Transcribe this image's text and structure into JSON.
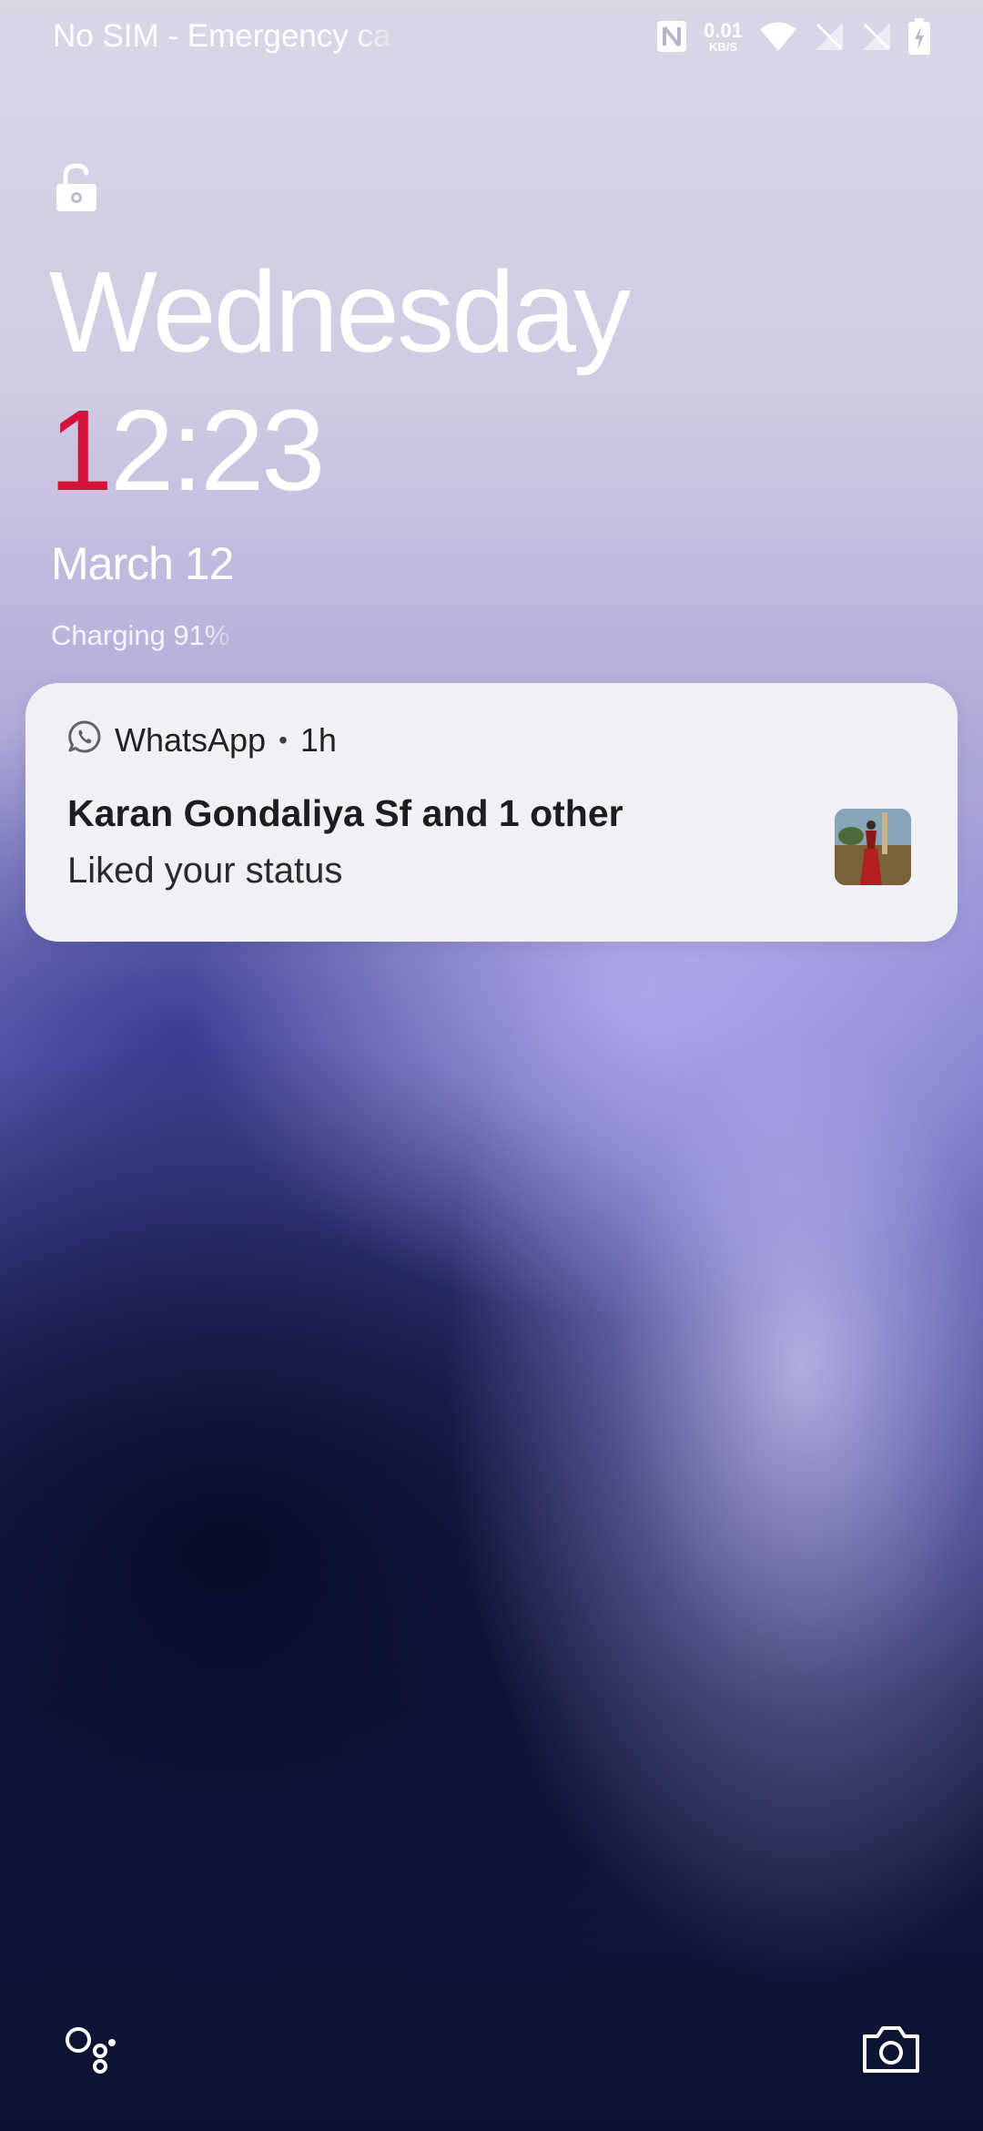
{
  "status_bar": {
    "carrier_text": "No SIM - Emergency ca",
    "net_speed_value": "0.01",
    "net_speed_unit": "KB/S",
    "icons": [
      "nfc-icon",
      "net-speed",
      "wifi-icon",
      "no-signal-icon",
      "no-signal-icon",
      "battery-charging-icon"
    ]
  },
  "lockscreen": {
    "lock_icon": "unlocked-padlock-icon",
    "day": "Wednesday",
    "time_first_digit": "1",
    "time_rest": "2:23",
    "date": "March 12",
    "charging": "Charging 91%",
    "accent_color": "#d4123c"
  },
  "notification": {
    "app_icon": "whatsapp-icon",
    "app_name": "WhatsApp",
    "separator": "•",
    "time_ago": "1h",
    "title": "Karan Gondaliya Sf and 1 other",
    "body": "Liked your status",
    "thumbnail": "status-photo-thumbnail"
  },
  "bottom_shortcuts": {
    "left": "assistant-icon",
    "right": "camera-icon"
  }
}
